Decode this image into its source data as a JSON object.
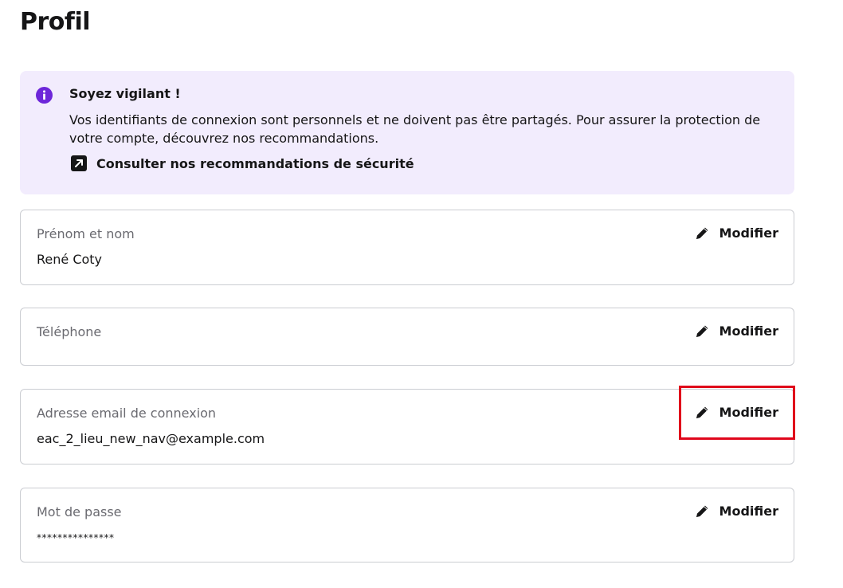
{
  "page": {
    "title": "Profil"
  },
  "callout": {
    "title": "Soyez vigilant !",
    "text": "Vos identifiants de connexion sont personnels et ne doivent pas être partagés. Pour assurer la protection de votre compte, découvrez nos recommandations.",
    "link_label": "Consulter nos recommandations de sécurité",
    "info_icon": "info-circle-icon",
    "link_icon": "external-link-icon"
  },
  "fields": {
    "name": {
      "label": "Prénom et nom",
      "value": "René Coty",
      "action": "Modifier"
    },
    "phone": {
      "label": "Téléphone",
      "value": "",
      "action": "Modifier"
    },
    "email": {
      "label": "Adresse email de connexion",
      "value": "eac_2_lieu_new_nav@example.com",
      "action": "Modifier"
    },
    "password": {
      "label": "Mot de passe",
      "value": "***************",
      "action": "Modifier"
    }
  },
  "colors": {
    "accent": "#6d26d9",
    "callout_bg": "#f2ecfd",
    "highlight": "#e0061b",
    "border": "#cbcdd2"
  }
}
